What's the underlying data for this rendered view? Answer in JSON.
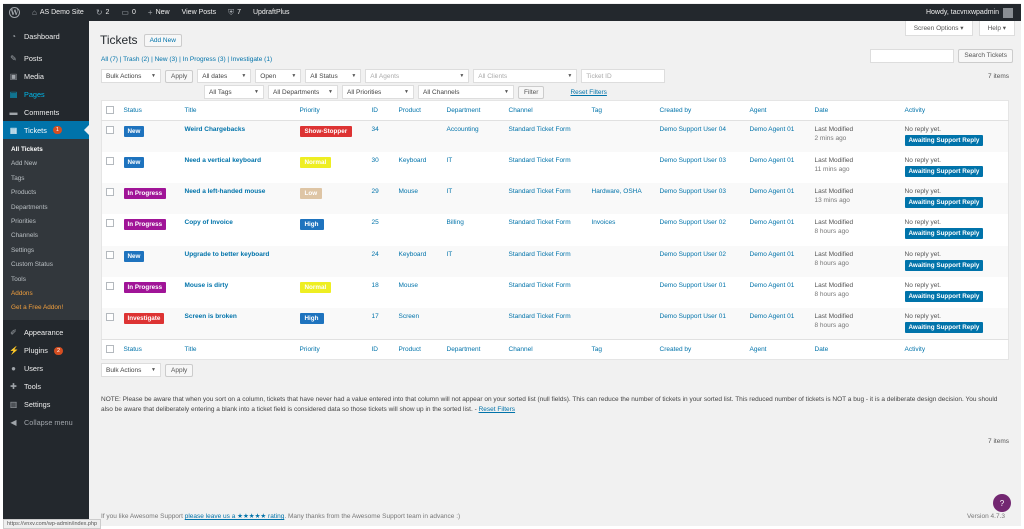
{
  "adminbar": {
    "site_name": "AS Demo Site",
    "updates_count": "2",
    "comments_count": "0",
    "new_label": "New",
    "view_posts": "View Posts",
    "plugin_count": "7",
    "updraft": "UpdraftPlus",
    "howdy": "Howdy, tacvnxwpadmin"
  },
  "sidebar": {
    "items": [
      {
        "label": "Dashboard",
        "icon": "dashboard-icon"
      },
      {
        "label": "Posts",
        "icon": "pin-icon"
      },
      {
        "label": "Media",
        "icon": "media-icon"
      },
      {
        "label": "Pages",
        "icon": "pages-icon"
      },
      {
        "label": "Comments",
        "icon": "comments-icon"
      },
      {
        "label": "Tickets",
        "icon": "tickets-icon",
        "badge": "1"
      }
    ],
    "submenu": [
      "All Tickets",
      "Add New",
      "Tags",
      "Products",
      "Departments",
      "Priorities",
      "Channels",
      "Settings",
      "Custom Status",
      "Tools",
      "Addons",
      "Get a Free Addon!"
    ],
    "items_after": [
      {
        "label": "Appearance",
        "icon": "brush-icon"
      },
      {
        "label": "Plugins",
        "icon": "plugins-icon",
        "badge": "2"
      },
      {
        "label": "Users",
        "icon": "users-icon"
      },
      {
        "label": "Tools",
        "icon": "tools-icon"
      },
      {
        "label": "Settings",
        "icon": "settings-icon"
      },
      {
        "label": "Collapse menu",
        "icon": "collapse-icon"
      }
    ]
  },
  "screen_options": "Screen Options ▾",
  "help": "Help ▾",
  "page_title": "Tickets",
  "add_new": "Add New",
  "views": "All (7) | Trash (2) | New (3) | In Progress (3) | Investigate (1)",
  "search_button": "Search Tickets",
  "items_count": "7 items",
  "filters": {
    "bulk_actions": "Bulk Actions",
    "apply": "Apply",
    "all_dates": "All dates",
    "open": "Open",
    "all_status": "All Status",
    "all_agents": "All Agents",
    "all_clients": "All Clients",
    "ticket_id": "Ticket ID",
    "all_tags": "All Tags",
    "all_departments": "All Departments",
    "all_priorities": "All Priorities",
    "all_channels": "All Channels",
    "filter": "Filter",
    "reset_filters": "Reset Filters"
  },
  "columns": [
    "Status",
    "Title",
    "Priority",
    "ID",
    "Product",
    "Department",
    "Channel",
    "Tag",
    "Created by",
    "Agent",
    "Date",
    "Activity"
  ],
  "rows": [
    {
      "status": "New",
      "status_color": "#1e73be",
      "title": "Weird Chargebacks",
      "priority": "Show-Stopper",
      "prio_bg": "#dd3333",
      "prio_fg": "#ffffff",
      "id": "34",
      "product": "",
      "department": "Accounting",
      "channel": "Standard Ticket Form",
      "tag": "",
      "created_by": "Demo Support User 04",
      "agent": "Demo Agent 01",
      "date_label": "Last Modified",
      "date_ago": "2 mins ago",
      "activity": "No reply yet.",
      "activity_btn": "Awaiting Support Reply"
    },
    {
      "status": "New",
      "status_color": "#1e73be",
      "title": "Need a vertical keyboard",
      "priority": "Normal",
      "prio_bg": "#eeee22",
      "prio_fg": "#ffffff",
      "id": "30",
      "product": "Keyboard",
      "department": "IT",
      "channel": "Standard Ticket Form",
      "tag": "",
      "created_by": "Demo Support User 03",
      "agent": "Demo Agent 01",
      "date_label": "Last Modified",
      "date_ago": "11 mins ago",
      "activity": "No reply yet.",
      "activity_btn": "Awaiting Support Reply"
    },
    {
      "status": "In Progress",
      "status_color": "#a01497",
      "title": "Need a left-handed mouse",
      "priority": "Low",
      "prio_bg": "#dec5a5",
      "prio_fg": "#ffffff",
      "id": "29",
      "product": "Mouse",
      "department": "IT",
      "channel": "Standard Ticket Form",
      "tag": "Hardware, OSHA",
      "created_by": "Demo Support User 03",
      "agent": "Demo Agent 01",
      "date_label": "Last Modified",
      "date_ago": "13 mins ago",
      "activity": "No reply yet.",
      "activity_btn": "Awaiting Support Reply"
    },
    {
      "status": "In Progress",
      "status_color": "#a01497",
      "title": "Copy of Invoice",
      "priority": "High",
      "prio_bg": "#1e73be",
      "prio_fg": "#ffffff",
      "id": "25",
      "product": "",
      "department": "Billing",
      "channel": "Standard Ticket Form",
      "tag": "Invoices",
      "created_by": "Demo Support User 02",
      "agent": "Demo Agent 01",
      "date_label": "Last Modified",
      "date_ago": "8 hours ago",
      "activity": "No reply yet.",
      "activity_btn": "Awaiting Support Reply"
    },
    {
      "status": "New",
      "status_color": "#1e73be",
      "title": "Upgrade to better keyboard",
      "priority": "",
      "prio_bg": "",
      "prio_fg": "",
      "id": "24",
      "product": "Keyboard",
      "department": "IT",
      "channel": "Standard Ticket Form",
      "tag": "",
      "created_by": "Demo Support User 02",
      "agent": "Demo Agent 01",
      "date_label": "Last Modified",
      "date_ago": "8 hours ago",
      "activity": "No reply yet.",
      "activity_btn": "Awaiting Support Reply"
    },
    {
      "status": "In Progress",
      "status_color": "#a01497",
      "title": "Mouse is dirty",
      "priority": "Normal",
      "prio_bg": "#eeee22",
      "prio_fg": "#ffffff",
      "id": "18",
      "product": "Mouse",
      "department": "",
      "channel": "Standard Ticket Form",
      "tag": "",
      "created_by": "Demo Support User 01",
      "agent": "Demo Agent 01",
      "date_label": "Last Modified",
      "date_ago": "8 hours ago",
      "activity": "No reply yet.",
      "activity_btn": "Awaiting Support Reply"
    },
    {
      "status": "Investigate",
      "status_color": "#dd3333",
      "title": "Screen is broken",
      "priority": "High",
      "prio_bg": "#1e73be",
      "prio_fg": "#ffffff",
      "id": "17",
      "product": "Screen",
      "department": "",
      "channel": "Standard Ticket Form",
      "tag": "",
      "created_by": "Demo Support User 01",
      "agent": "Demo Agent 01",
      "date_label": "Last Modified",
      "date_ago": "8 hours ago",
      "activity": "No reply yet.",
      "activity_btn": "Awaiting Support Reply"
    }
  ],
  "note": "NOTE: Please be aware that when you sort on a column, tickets that have never had a value entered into that column will not appear on your sorted list (null fields). This can reduce the number of tickets in your sorted list. This reduced number of tickets is NOT a bug - it is a deliberate design decision. You should also be aware that deliberately entering a blank into a ticket field is considered data so those tickets will show up in the sorted list. -",
  "note_link": "Reset Filters",
  "footer_left_pre": "If you like Awesome Support",
  "footer_left_link": "please leave us a ★★★★★ rating",
  "footer_left_post": ". Many thanks from the Awesome Support team in advance :)",
  "footer_version": "Version 4.7.3",
  "status_url": "https://vnxv.com/wp-admin/index.php"
}
